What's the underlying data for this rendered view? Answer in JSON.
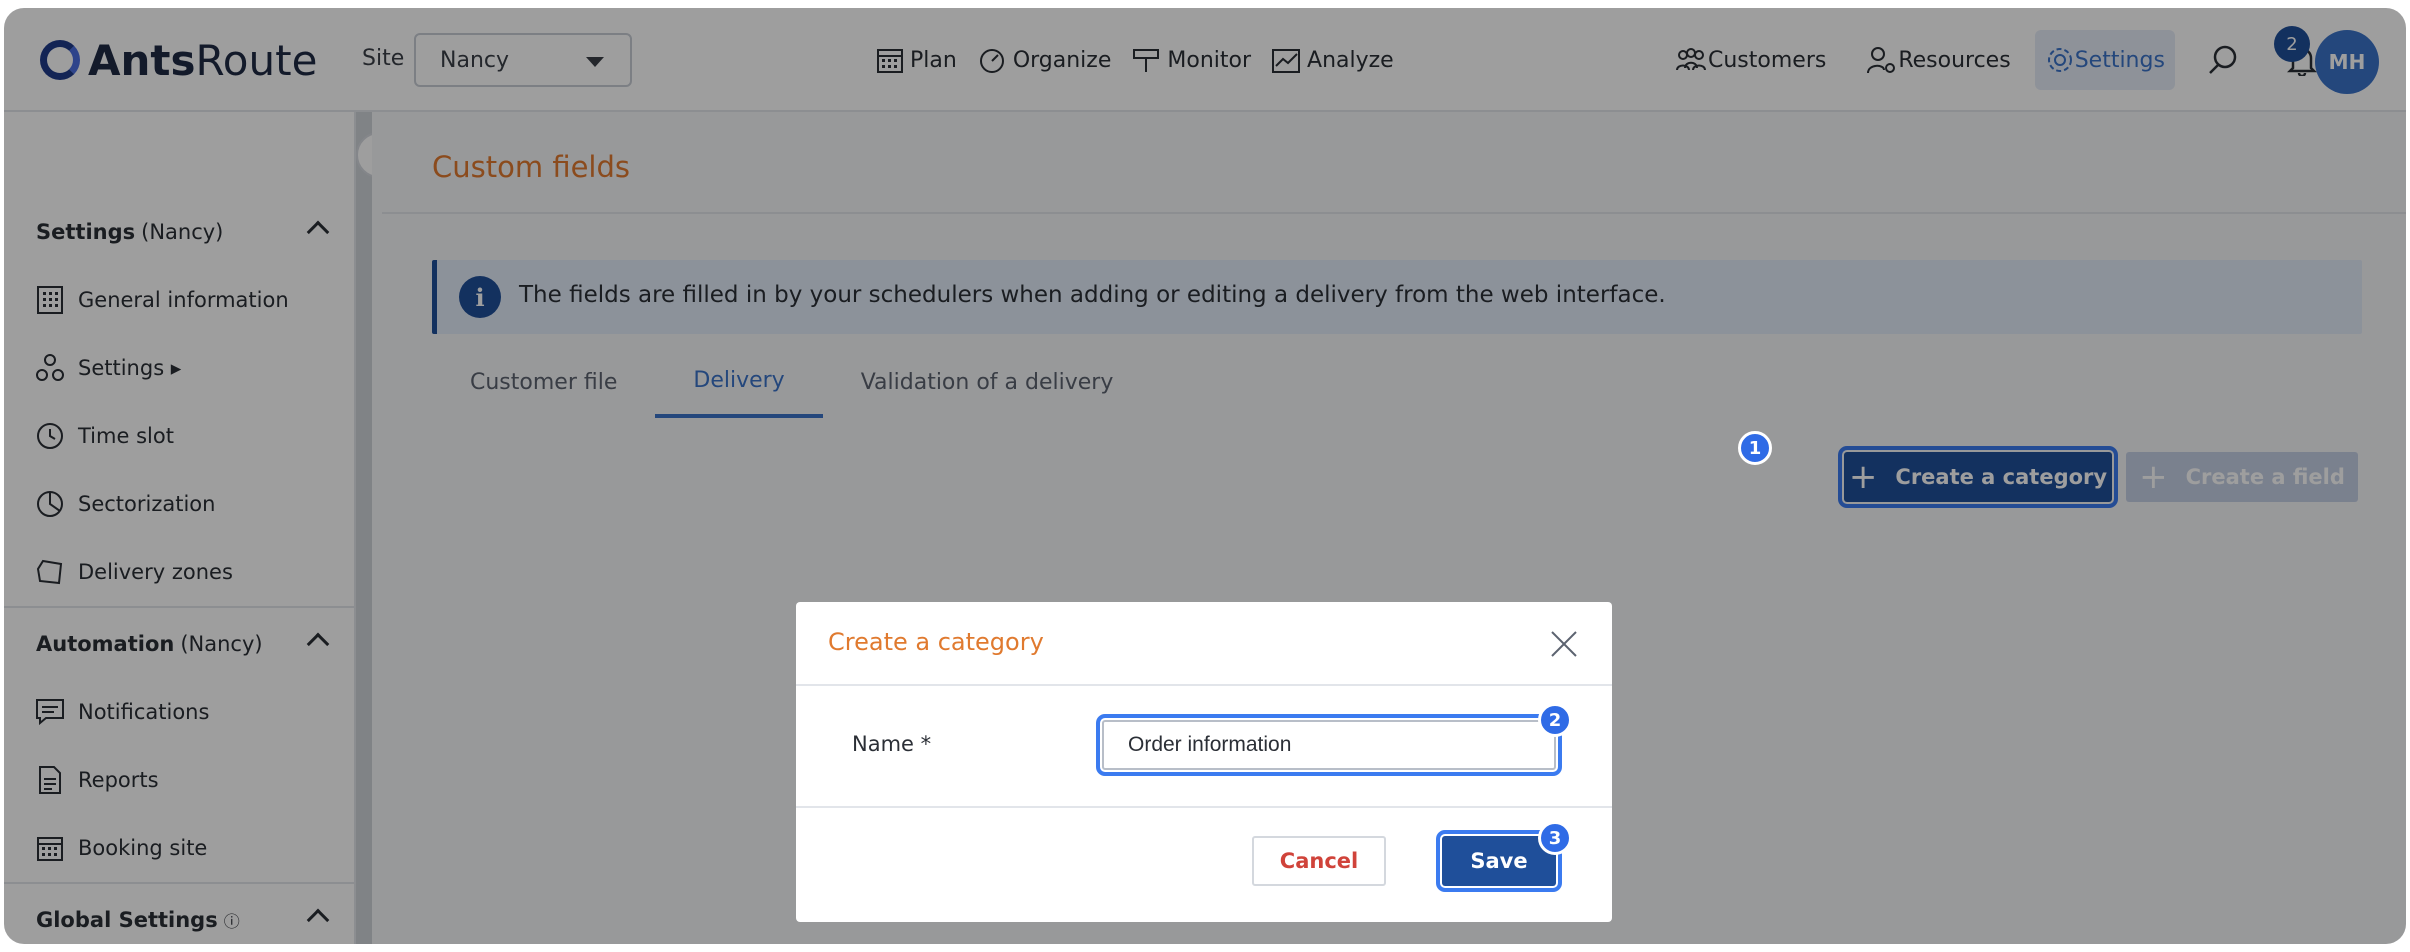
{
  "app": {
    "logo_bold": "Ants",
    "logo_regular": "Route"
  },
  "header": {
    "site_label": "Site",
    "site_value": "Nancy",
    "nav": [
      {
        "label": "Plan",
        "icon": "calendar-icon"
      },
      {
        "label": "Organize",
        "icon": "gauge-icon"
      },
      {
        "label": "Monitor",
        "icon": "signpost-icon"
      },
      {
        "label": "Analyze",
        "icon": "chart-icon"
      }
    ],
    "customers_label": "Customers",
    "resources_label": "Resources",
    "settings_label": "Settings",
    "notifications_count": "2",
    "avatar_initials": "MH"
  },
  "sidebar": {
    "section_settings": {
      "title": "Settings",
      "scope": "(Nancy)"
    },
    "settings_items": [
      {
        "label": "General information",
        "icon": "building-icon"
      },
      {
        "label": "Settings ▸",
        "icon": "nodes-icon"
      },
      {
        "label": "Time slot",
        "icon": "clock-icon"
      },
      {
        "label": "Sectorization",
        "icon": "pie-icon"
      },
      {
        "label": "Delivery zones",
        "icon": "polygon-icon"
      }
    ],
    "section_automation": {
      "title": "Automation",
      "scope": "(Nancy)"
    },
    "automation_items": [
      {
        "label": "Notifications",
        "icon": "message-icon"
      },
      {
        "label": "Reports",
        "icon": "document-icon"
      },
      {
        "label": "Booking site",
        "icon": "calendar-icon"
      }
    ],
    "section_global": {
      "title": "Global Settings",
      "info": "ⓘ"
    }
  },
  "main": {
    "page_title": "Custom fields",
    "info_text": "The fields are filled in by your schedulers when adding or editing a delivery from the web interface.",
    "tabs": [
      "Customer file",
      "Delivery",
      "Validation of a delivery"
    ],
    "active_tab": "Delivery",
    "create_category_label": "Create a category",
    "create_field_label": "Create a field"
  },
  "modal": {
    "title": "Create a category",
    "name_label": "Name *",
    "name_value": "Order information",
    "cancel_label": "Cancel",
    "save_label": "Save"
  },
  "step_badges": [
    "1",
    "2",
    "3"
  ],
  "colors": {
    "accent_orange": "#e07a2f",
    "primary_blue": "#1f4f9a",
    "highlight_blue": "#3b7bf0"
  }
}
